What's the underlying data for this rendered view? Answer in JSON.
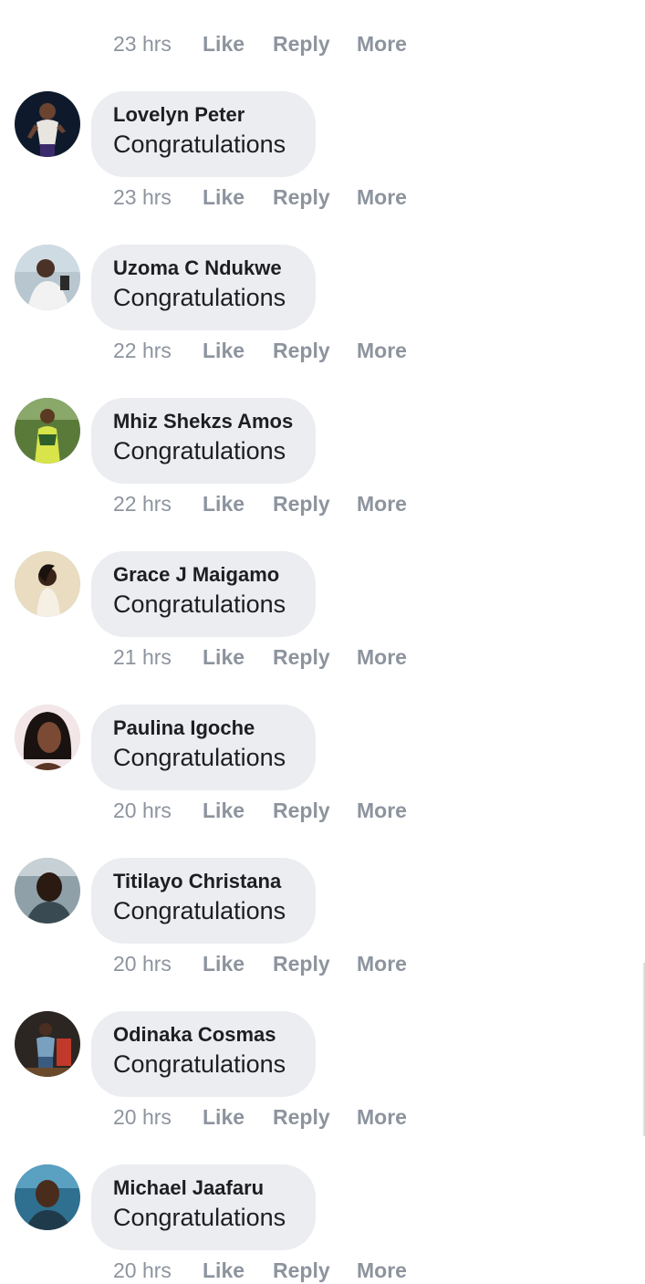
{
  "comments": [
    {
      "author": "",
      "text": "",
      "time": "23 hrs",
      "avatar_icon": "profile-photo",
      "avatar_bg": "#cfd3d8"
    },
    {
      "author": "Lovelyn Peter",
      "text": "Congratulations",
      "time": "23 hrs",
      "avatar_icon": "profile-photo",
      "avatar_bg": "#0e1a2c"
    },
    {
      "author": "Uzoma C Ndukwe",
      "text": "Congratulations",
      "time": "22 hrs",
      "avatar_icon": "profile-photo",
      "avatar_bg": "#b8c6cf"
    },
    {
      "author": "Mhiz Shekzs Amos",
      "text": "Congratulations",
      "time": "22 hrs",
      "avatar_icon": "profile-photo",
      "avatar_bg": "#5a7a3a"
    },
    {
      "author": "Grace J Maigamo",
      "text": "Congratulations",
      "time": "21 hrs",
      "avatar_icon": "profile-photo",
      "avatar_bg": "#e9dcc0"
    },
    {
      "author": "Paulina Igoche",
      "text": "Congratulations",
      "time": "20 hrs",
      "avatar_icon": "profile-photo",
      "avatar_bg": "#f2e6e8"
    },
    {
      "author": "Titilayo Christana",
      "text": "Congratulations",
      "time": "20 hrs",
      "avatar_icon": "profile-photo",
      "avatar_bg": "#8fa0a8"
    },
    {
      "author": "Odinaka Cosmas",
      "text": "Congratulations",
      "time": "20 hrs",
      "avatar_icon": "profile-photo",
      "avatar_bg": "#2c2622"
    },
    {
      "author": "Michael Jaafaru",
      "text": "Congratulations",
      "time": "20 hrs",
      "avatar_icon": "profile-photo",
      "avatar_bg": "#2f6f8f"
    }
  ],
  "actions": {
    "like": "Like",
    "reply": "Reply",
    "more": "More"
  },
  "colors": {
    "bubble": "#ebedf0",
    "meta_text": "#8d949e",
    "name_text": "#1c1e21"
  }
}
